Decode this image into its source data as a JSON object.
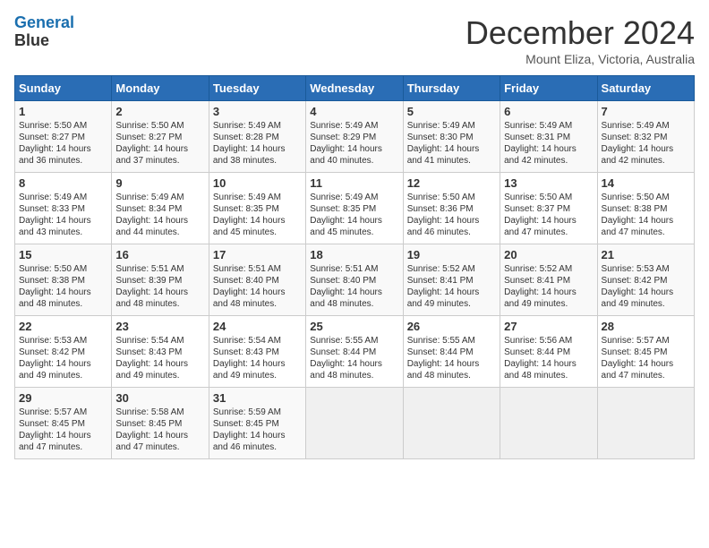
{
  "header": {
    "logo_line1": "General",
    "logo_line2": "Blue",
    "month_title": "December 2024",
    "location": "Mount Eliza, Victoria, Australia"
  },
  "weekdays": [
    "Sunday",
    "Monday",
    "Tuesday",
    "Wednesday",
    "Thursday",
    "Friday",
    "Saturday"
  ],
  "weeks": [
    [
      {
        "day": "1",
        "sunrise": "5:50 AM",
        "sunset": "8:27 PM",
        "daylight": "14 hours and 36 minutes."
      },
      {
        "day": "2",
        "sunrise": "5:50 AM",
        "sunset": "8:27 PM",
        "daylight": "14 hours and 37 minutes."
      },
      {
        "day": "3",
        "sunrise": "5:49 AM",
        "sunset": "8:28 PM",
        "daylight": "14 hours and 38 minutes."
      },
      {
        "day": "4",
        "sunrise": "5:49 AM",
        "sunset": "8:29 PM",
        "daylight": "14 hours and 40 minutes."
      },
      {
        "day": "5",
        "sunrise": "5:49 AM",
        "sunset": "8:30 PM",
        "daylight": "14 hours and 41 minutes."
      },
      {
        "day": "6",
        "sunrise": "5:49 AM",
        "sunset": "8:31 PM",
        "daylight": "14 hours and 42 minutes."
      },
      {
        "day": "7",
        "sunrise": "5:49 AM",
        "sunset": "8:32 PM",
        "daylight": "14 hours and 42 minutes."
      }
    ],
    [
      {
        "day": "8",
        "sunrise": "5:49 AM",
        "sunset": "8:33 PM",
        "daylight": "14 hours and 43 minutes."
      },
      {
        "day": "9",
        "sunrise": "5:49 AM",
        "sunset": "8:34 PM",
        "daylight": "14 hours and 44 minutes."
      },
      {
        "day": "10",
        "sunrise": "5:49 AM",
        "sunset": "8:35 PM",
        "daylight": "14 hours and 45 minutes."
      },
      {
        "day": "11",
        "sunrise": "5:49 AM",
        "sunset": "8:35 PM",
        "daylight": "14 hours and 45 minutes."
      },
      {
        "day": "12",
        "sunrise": "5:50 AM",
        "sunset": "8:36 PM",
        "daylight": "14 hours and 46 minutes."
      },
      {
        "day": "13",
        "sunrise": "5:50 AM",
        "sunset": "8:37 PM",
        "daylight": "14 hours and 47 minutes."
      },
      {
        "day": "14",
        "sunrise": "5:50 AM",
        "sunset": "8:38 PM",
        "daylight": "14 hours and 47 minutes."
      }
    ],
    [
      {
        "day": "15",
        "sunrise": "5:50 AM",
        "sunset": "8:38 PM",
        "daylight": "14 hours and 48 minutes."
      },
      {
        "day": "16",
        "sunrise": "5:51 AM",
        "sunset": "8:39 PM",
        "daylight": "14 hours and 48 minutes."
      },
      {
        "day": "17",
        "sunrise": "5:51 AM",
        "sunset": "8:40 PM",
        "daylight": "14 hours and 48 minutes."
      },
      {
        "day": "18",
        "sunrise": "5:51 AM",
        "sunset": "8:40 PM",
        "daylight": "14 hours and 48 minutes."
      },
      {
        "day": "19",
        "sunrise": "5:52 AM",
        "sunset": "8:41 PM",
        "daylight": "14 hours and 49 minutes."
      },
      {
        "day": "20",
        "sunrise": "5:52 AM",
        "sunset": "8:41 PM",
        "daylight": "14 hours and 49 minutes."
      },
      {
        "day": "21",
        "sunrise": "5:53 AM",
        "sunset": "8:42 PM",
        "daylight": "14 hours and 49 minutes."
      }
    ],
    [
      {
        "day": "22",
        "sunrise": "5:53 AM",
        "sunset": "8:42 PM",
        "daylight": "14 hours and 49 minutes."
      },
      {
        "day": "23",
        "sunrise": "5:54 AM",
        "sunset": "8:43 PM",
        "daylight": "14 hours and 49 minutes."
      },
      {
        "day": "24",
        "sunrise": "5:54 AM",
        "sunset": "8:43 PM",
        "daylight": "14 hours and 49 minutes."
      },
      {
        "day": "25",
        "sunrise": "5:55 AM",
        "sunset": "8:44 PM",
        "daylight": "14 hours and 48 minutes."
      },
      {
        "day": "26",
        "sunrise": "5:55 AM",
        "sunset": "8:44 PM",
        "daylight": "14 hours and 48 minutes."
      },
      {
        "day": "27",
        "sunrise": "5:56 AM",
        "sunset": "8:44 PM",
        "daylight": "14 hours and 48 minutes."
      },
      {
        "day": "28",
        "sunrise": "5:57 AM",
        "sunset": "8:45 PM",
        "daylight": "14 hours and 47 minutes."
      }
    ],
    [
      {
        "day": "29",
        "sunrise": "5:57 AM",
        "sunset": "8:45 PM",
        "daylight": "14 hours and 47 minutes."
      },
      {
        "day": "30",
        "sunrise": "5:58 AM",
        "sunset": "8:45 PM",
        "daylight": "14 hours and 47 minutes."
      },
      {
        "day": "31",
        "sunrise": "5:59 AM",
        "sunset": "8:45 PM",
        "daylight": "14 hours and 46 minutes."
      },
      null,
      null,
      null,
      null
    ]
  ]
}
